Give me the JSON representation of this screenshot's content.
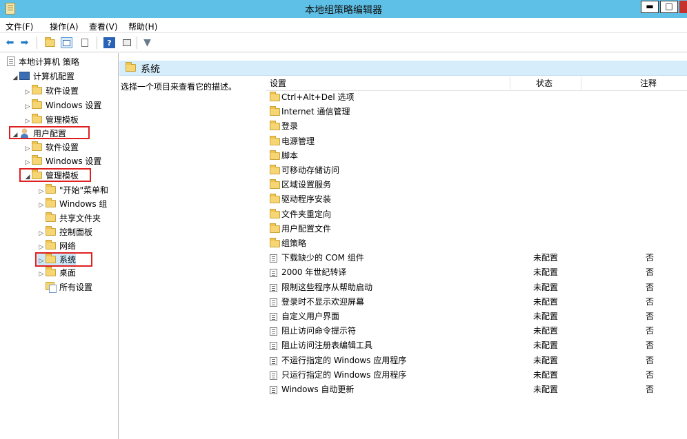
{
  "window": {
    "title": "本地组策略编辑器"
  },
  "menu": [
    "文件(F)",
    "操作(A)",
    "查看(V)",
    "帮助(H)"
  ],
  "tree": {
    "root": "本地计算机 策略",
    "computer_config": "计算机配置",
    "software_settings_1": "软件设置",
    "windows_settings_1": "Windows 设置",
    "admin_templates_1": "管理模板",
    "user_config": "用户配置",
    "software_settings_2": "软件设置",
    "windows_settings_2": "Windows 设置",
    "admin_templates_2": "管理模板",
    "start_menu": "\"开始\"菜单和",
    "windows_components": "Windows 组",
    "shared_folders": "共享文件夹",
    "control_panel": "控制面板",
    "network": "网络",
    "system": "系统",
    "desktop": "桌面",
    "all_settings": "所有设置"
  },
  "content": {
    "title": "系统",
    "description": "选择一个项目来查看它的描述。",
    "columns": {
      "setting": "设置",
      "state": "状态",
      "comment": "注释"
    },
    "folders": [
      "Ctrl+Alt+Del 选项",
      "Internet 通信管理",
      "登录",
      "电源管理",
      "脚本",
      "可移动存储访问",
      "区域设置服务",
      "驱动程序安装",
      "文件夹重定向",
      "用户配置文件",
      "组策略"
    ],
    "settings": [
      {
        "name": "下载缺少的 COM 组件",
        "state": "未配置",
        "comment": "否"
      },
      {
        "name": "2000 年世纪转译",
        "state": "未配置",
        "comment": "否"
      },
      {
        "name": "限制这些程序从帮助启动",
        "state": "未配置",
        "comment": "否"
      },
      {
        "name": "登录时不显示欢迎屏幕",
        "state": "未配置",
        "comment": "否"
      },
      {
        "name": "自定义用户界面",
        "state": "未配置",
        "comment": "否"
      },
      {
        "name": "阻止访问命令提示符",
        "state": "未配置",
        "comment": "否"
      },
      {
        "name": "阻止访问注册表编辑工具",
        "state": "未配置",
        "comment": "否"
      },
      {
        "name": "不运行指定的 Windows 应用程序",
        "state": "未配置",
        "comment": "否"
      },
      {
        "name": "只运行指定的 Windows 应用程序",
        "state": "未配置",
        "comment": "否"
      },
      {
        "name": "Windows 自动更新",
        "state": "未配置",
        "comment": "否"
      }
    ]
  }
}
